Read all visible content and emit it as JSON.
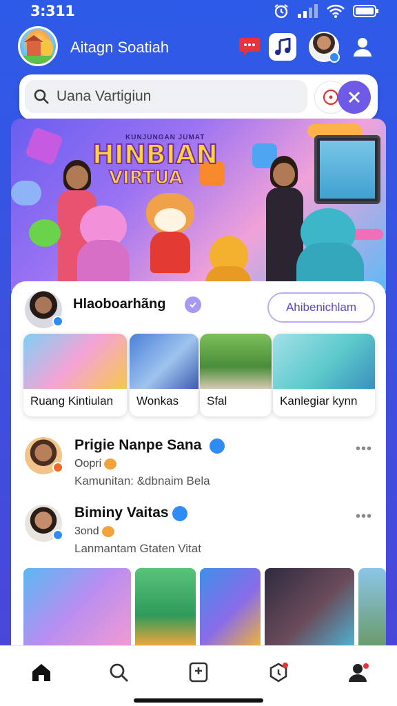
{
  "status_bar": {
    "time": "3:311"
  },
  "header": {
    "app_name": "Aitagn Soatiah",
    "icons": [
      "logo",
      "notification-icon",
      "music-icon",
      "avatar",
      "profile-icon"
    ]
  },
  "search": {
    "placeholder": "Uana Vartigiun"
  },
  "banner": {
    "subtitle": "KUNJUNGAN JUMAT",
    "title_line1": "HINBIAN",
    "title_line2": "VIRTUA"
  },
  "category_card": {
    "title": "Hlaoboarhãng",
    "follow_label": "Ahibenichlam",
    "tiles": [
      {
        "label": "Ruang Kintiulan"
      },
      {
        "label": "Wonkas"
      },
      {
        "label": "Sfal"
      },
      {
        "label": "Kanlegiar kynn"
      }
    ]
  },
  "posts": [
    {
      "name": "Prigie Nanpe Sana",
      "meta": "Oopri",
      "description": "Kamunitan: &dbnaim Bela"
    },
    {
      "name": "Biminy Vaitas",
      "meta": "3ond",
      "description": "Lanmantam Gtaten Vitat"
    }
  ],
  "bottom_nav": [
    "home",
    "search",
    "create",
    "activity",
    "profile"
  ],
  "colors": {
    "accent": "#6f5ae8",
    "primary_bg": "#2d5be8",
    "verified": "#2f8cf5"
  }
}
